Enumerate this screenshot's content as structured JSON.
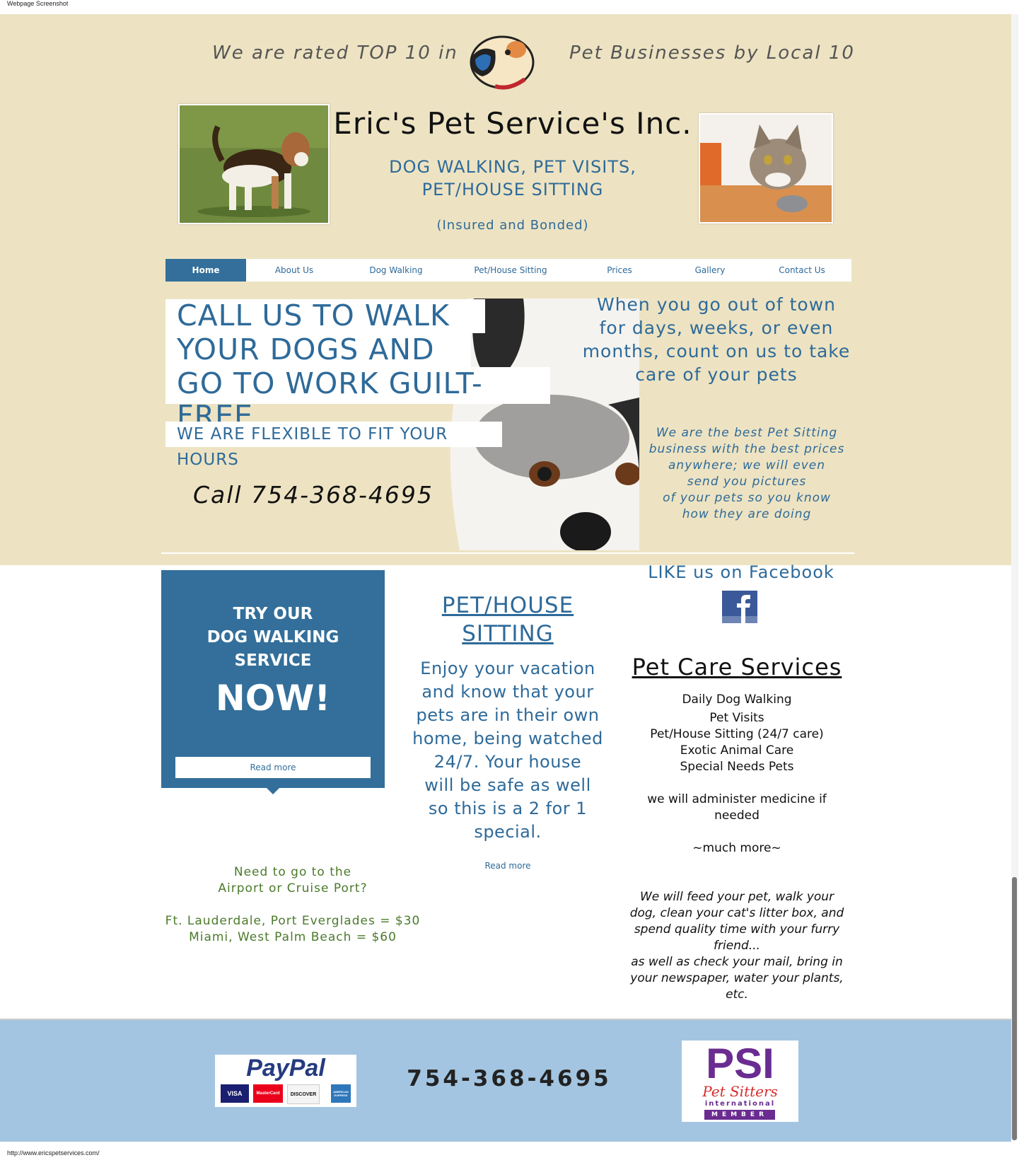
{
  "browser": {
    "caption": "Webpage Screenshot",
    "url": "http://www.ericspetservices.com/"
  },
  "header": {
    "rated_left": "We are rated TOP 10 in",
    "rated_right": "Pet Businesses by Local 10",
    "title": "Eric's Pet Service's Inc.",
    "services_line1": "DOG WALKING, PET VISITS,",
    "services_line2": "PET/HOUSE SITTING",
    "insured": "(Insured and Bonded)"
  },
  "nav": {
    "items": [
      "Home",
      "About Us",
      "Dog Walking",
      "Pet/House Sitting",
      "Prices",
      "Gallery",
      "Contact Us"
    ],
    "active": "Home"
  },
  "hero": {
    "line1": "CALL US TO WALK",
    "line2": "YOUR DOGS AND",
    "line3": "GO TO WORK GUILT-FREE",
    "flexible": "WE ARE FLEXIBLE TO FIT YOUR HOURS",
    "call": "Call 754-368-4695",
    "out_of_town": [
      "When you go out of town",
      "for days, weeks, or even",
      "months, count on us to take",
      "care of your pets"
    ],
    "best": [
      "We are the best Pet Sitting",
      "business with the best prices",
      "anywhere; we will even",
      "send you pictures",
      "of your pets so you know",
      "how they are doing"
    ]
  },
  "promo": {
    "try_lines": [
      "TRY OUR",
      "DOG WALKING",
      "SERVICE"
    ],
    "now": "NOW!",
    "read_more": "Read more"
  },
  "airport": {
    "lines": [
      "Need to go to the",
      "Airport or Cruise Port?",
      "",
      "Ft. Lauderdale, Port Everglades = $30",
      "Miami, West Palm Beach = $60"
    ]
  },
  "sitting": {
    "heading1": "PET/HOUSE",
    "heading2": "SITTING",
    "body": [
      "Enjoy your vacation",
      "and know that your",
      "pets are in their own",
      "home, being watched",
      "24/7.  Your house",
      "will be safe as well",
      "so this is a 2 for 1",
      "special."
    ],
    "read_more": "Read more"
  },
  "facebook": {
    "label": "LIKE us on Facebook"
  },
  "services": {
    "heading": "Pet Care Services",
    "items": [
      "Daily Dog Walking",
      "Pet Visits",
      "Pet/House Sitting (24/7 care)",
      "Exotic Animal Care",
      "Special Needs Pets"
    ],
    "medicine": [
      "we will administer medicine if",
      "needed"
    ],
    "more": "~much more~",
    "feed": [
      "We will feed your pet, walk your",
      "dog, clean your cat's litter box, and",
      "spend quality time with your furry",
      "friend...",
      "as well as check your mail, bring in",
      "your newspaper, water your plants,",
      "etc."
    ]
  },
  "footer": {
    "paypal": "PayPal",
    "cards": [
      "VISA",
      "MasterCard",
      "DISCOVER",
      "AMERICAN EXPRESS"
    ],
    "phone": "754-368-4695",
    "psi": "PSI",
    "psi_sub1": "Pet Sitters",
    "psi_sub2": "international",
    "psi_member": "MEMBER"
  }
}
